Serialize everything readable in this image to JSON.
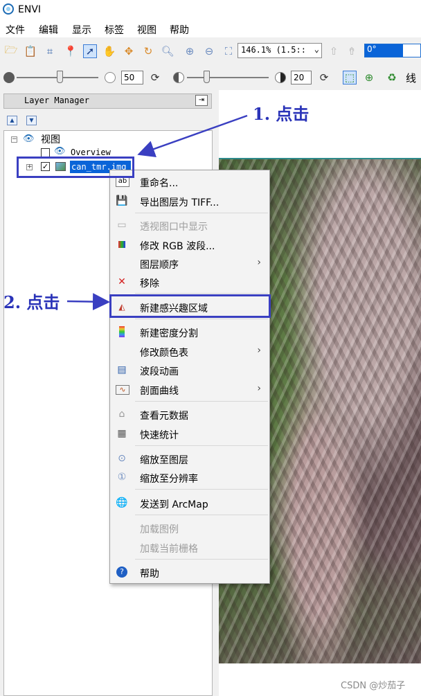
{
  "window": {
    "title": "ENVI"
  },
  "menubar": {
    "items": [
      "文件",
      "编辑",
      "显示",
      "标签",
      "视图",
      "帮助"
    ]
  },
  "toolbar1": {
    "zoom_value": "146.1% (1.5::",
    "rotation_value": "0°"
  },
  "toolbar2": {
    "brightness_value": "50",
    "contrast_value": "20",
    "trailing_label": "线"
  },
  "layer_manager": {
    "title": "Layer Manager",
    "tree": {
      "root_label": "视图",
      "overview_label": "Overview",
      "layer_label": "can_tmr.img"
    }
  },
  "context_menu": {
    "items": [
      {
        "label": "重命名...",
        "icon": "rename-icon",
        "enabled": true
      },
      {
        "label": "导出图层为 TIFF...",
        "icon": "save-icon",
        "enabled": true
      },
      {
        "label": "透视图口中显示",
        "icon": "window-icon",
        "enabled": false
      },
      {
        "label": "修改 RGB 波段...",
        "icon": "rgb-icon",
        "enabled": true
      },
      {
        "label": "图层顺序",
        "icon": "",
        "enabled": true,
        "submenu": true
      },
      {
        "label": "移除",
        "icon": "remove-icon",
        "enabled": true
      },
      {
        "label": "新建感兴趣区域",
        "icon": "roi-icon",
        "enabled": true,
        "highlighted": true
      },
      {
        "label": "新建密度分割",
        "icon": "density-slice-icon",
        "enabled": true
      },
      {
        "label": "修改颜色表",
        "icon": "",
        "enabled": true,
        "submenu": true
      },
      {
        "label": "波段动画",
        "icon": "animation-icon",
        "enabled": true
      },
      {
        "label": "剖面曲线",
        "icon": "profile-icon",
        "enabled": true,
        "submenu": true
      },
      {
        "label": "查看元数据",
        "icon": "tag-icon",
        "enabled": true
      },
      {
        "label": "快速统计",
        "icon": "calculator-icon",
        "enabled": true
      },
      {
        "label": "缩放至图层",
        "icon": "zoom-layer-icon",
        "enabled": true
      },
      {
        "label": "缩放至分辨率",
        "icon": "zoom-resolution-icon",
        "enabled": true
      },
      {
        "label": "发送到 ArcMap",
        "icon": "arcmap-icon",
        "enabled": true
      },
      {
        "label": "加载图例",
        "icon": "",
        "enabled": false
      },
      {
        "label": "加载当前栅格",
        "icon": "",
        "enabled": false
      },
      {
        "label": "帮助",
        "icon": "help-icon",
        "enabled": true
      }
    ]
  },
  "annotations": {
    "step1": "1. 点击",
    "step2": "2. 点击"
  },
  "watermark": "CSDN @炒茄子",
  "colors": {
    "annotation": "#2a33b8",
    "selection": "#0a64d8"
  }
}
